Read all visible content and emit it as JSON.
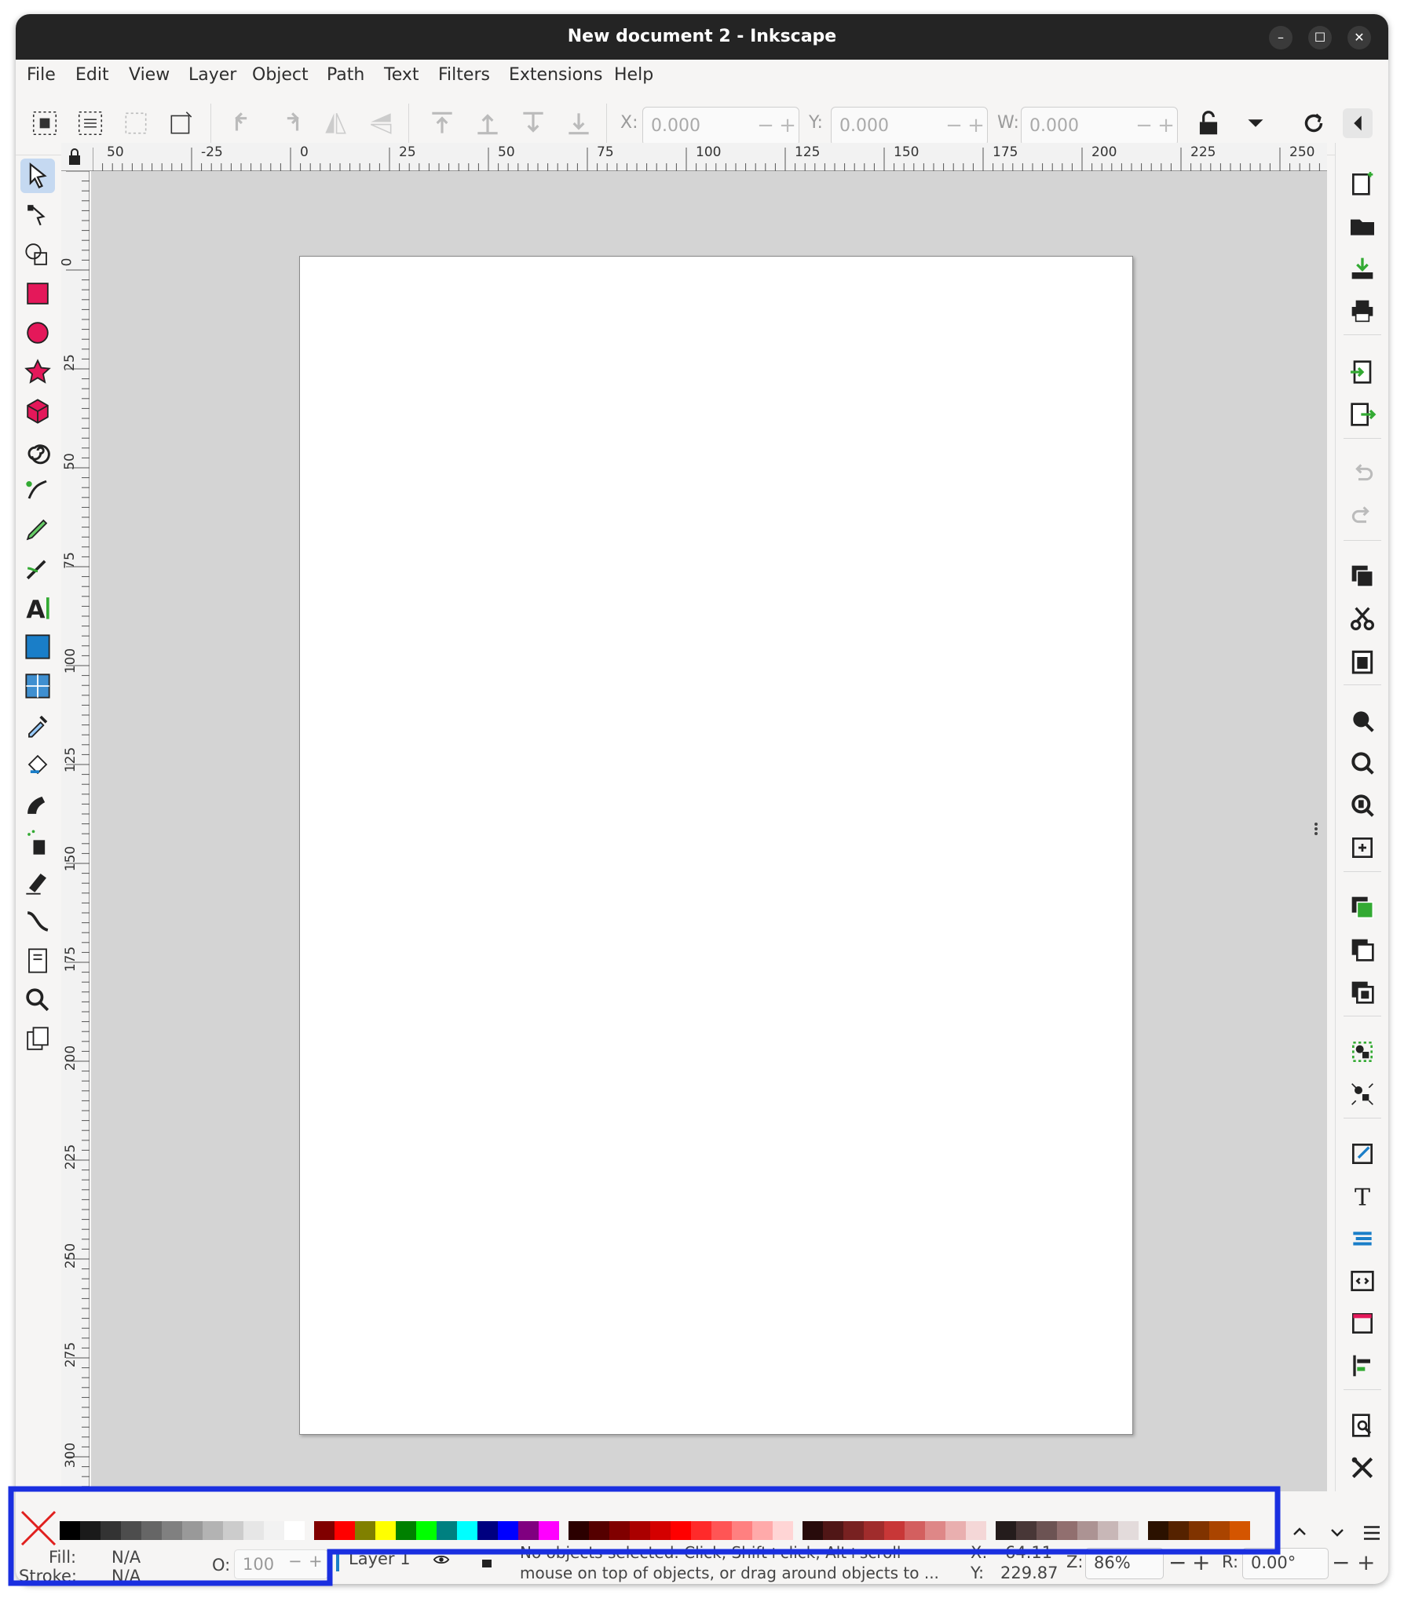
{
  "window": {
    "title": "New document 2 - Inkscape",
    "controls": [
      "minimize-icon",
      "maximize-icon",
      "close-icon"
    ]
  },
  "menu": [
    "File",
    "Edit",
    "View",
    "Layer",
    "Object",
    "Path",
    "Text",
    "Filters",
    "Extensions",
    "Help"
  ],
  "toolbar": {
    "x_label": "X:",
    "x_value": "0.000",
    "y_label": "Y:",
    "y_value": "0.000",
    "w_label": "W:",
    "w_value": "0.000"
  },
  "rulers": {
    "top_labels": [
      "50",
      "-25",
      "0",
      "25",
      "50",
      "75",
      "100",
      "125",
      "150",
      "175",
      "200",
      "225",
      "250"
    ],
    "left_labels": [
      "0",
      "25",
      "50",
      "75",
      "100",
      "125",
      "150",
      "175",
      "200",
      "225",
      "250",
      "275",
      "300"
    ]
  },
  "status": {
    "fill_label": "Fill:",
    "fill_value": "N/A",
    "stroke_label": "Stroke:",
    "stroke_value": "N/A",
    "opacity_label": "O:",
    "opacity_value": "100",
    "layer_name": "Layer 1",
    "message_line1": "No objects selected. Click, Shift+click, Alt+scroll",
    "message_line2": "mouse on top of objects, or drag around objects to ...",
    "x_label": "X:",
    "x_value": "64.11",
    "y_label": "Y:",
    "y_value": "229.87",
    "zoom_label": "Z:",
    "zoom_value": "86%",
    "rotate_label": "R:",
    "rotate_value": "0.00°"
  },
  "palette": {
    "none_swatch": "none-swatch-icon",
    "colors": [
      "#000000",
      "#1a1a1a",
      "#333333",
      "#4d4d4d",
      "#666666",
      "#808080",
      "#999999",
      "#b3b3b3",
      "#cccccc",
      "#e6e6e6",
      "#f2f2f2",
      "#ffffff",
      "#800000",
      "#ff0000",
      "#808000",
      "#ffff00",
      "#008000",
      "#00ff00",
      "#008080",
      "#00ffff",
      "#000080",
      "#0000ff",
      "#800080",
      "#ff00ff",
      "#2b0000",
      "#550000",
      "#800000",
      "#aa0000",
      "#d40000",
      "#ff0000",
      "#ff2a2a",
      "#ff5555",
      "#ff8080",
      "#ffaaaa",
      "#ffd5d5",
      "#280b0b",
      "#501616",
      "#782121",
      "#a02c2c",
      "#c83737",
      "#d35f5f",
      "#de8787",
      "#e9afaf",
      "#f4d7d7",
      "#241c1c",
      "#483737",
      "#6c5353",
      "#916f6f",
      "#ac9393",
      "#c8b7b7",
      "#e3dbdb",
      "#2b1100",
      "#552200",
      "#803300",
      "#aa4400",
      "#d45500"
    ]
  },
  "highlight_color": "#1a2fe0",
  "accent": "#c5d9f1"
}
